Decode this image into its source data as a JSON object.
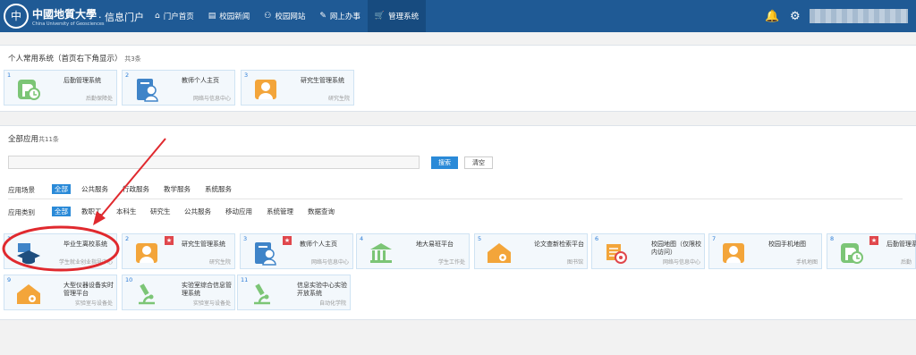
{
  "header": {
    "logo_mark": "中",
    "logo_text": "中國地質大學",
    "logo_sub": "China University of Geosciences",
    "portal_title": "· 信息门户",
    "nav": [
      {
        "label": "门户首页",
        "icon": "⌂"
      },
      {
        "label": "校园新闻",
        "icon": "▤"
      },
      {
        "label": "校园网站",
        "icon": "⚇"
      },
      {
        "label": "网上办事",
        "icon": "✎"
      },
      {
        "label": "管理系统",
        "icon": "🛒"
      }
    ],
    "bell_icon": "🔔",
    "gear_icon": "⚙"
  },
  "common": {
    "title": "个人常用系统（首页右下角显示）",
    "count": "共3条",
    "cards": [
      {
        "num": "1",
        "name": "后勤管理系统",
        "dept": "后勤保障处",
        "icon": "logistics-icon"
      },
      {
        "num": "2",
        "name": "教师个人主页",
        "dept": "网络与信息中心",
        "icon": "teacher-icon"
      },
      {
        "num": "3",
        "name": "研究生管理系统",
        "dept": "研究生院",
        "icon": "graduate-icon"
      }
    ]
  },
  "all": {
    "title": "全部应用",
    "count": "共11条",
    "search_placeholder": "",
    "search_label": "搜索",
    "clear_label": "清空",
    "scene_label": "应用场景",
    "scene_options": [
      "全部",
      "公共服务",
      "行政服务",
      "教学服务",
      "系统服务"
    ],
    "type_label": "应用类别",
    "type_options": [
      "全部",
      "教职工",
      "本科生",
      "研究生",
      "公共服务",
      "移动应用",
      "系统管理",
      "数据查询"
    ],
    "cards": [
      {
        "num": "1",
        "name": "毕业生离校系统",
        "dept": "学生就业创业指导中心",
        "icon": "graduation-icon",
        "star": false
      },
      {
        "num": "2",
        "name": "研究生管理系统",
        "dept": "研究生院",
        "icon": "graduate-icon",
        "star": true
      },
      {
        "num": "3",
        "name": "教师个人主页",
        "dept": "网络与信息中心",
        "icon": "teacher-icon",
        "star": true
      },
      {
        "num": "4",
        "name": "地大易班平台",
        "dept": "学生工作处",
        "icon": "library-icon",
        "star": false
      },
      {
        "num": "5",
        "name": "论文查新检索平台",
        "dept": "图书馆",
        "icon": "house-gear-icon",
        "star": false
      },
      {
        "num": "6",
        "name": "校园地图（仅限校内访问）",
        "dept": "网络与信息中心",
        "icon": "map-gear-icon",
        "star": false
      },
      {
        "num": "7",
        "name": "校园手机地图",
        "dept": "手机地图",
        "icon": "person-icon",
        "star": false
      },
      {
        "num": "8",
        "name": "后勤管理系统",
        "dept": "后勤",
        "icon": "logistics-icon",
        "star": true
      },
      {
        "num": "9",
        "name": "大型仪器设备实时管理平台",
        "dept": "实验室与设备处",
        "icon": "house-gear-icon",
        "star": false
      },
      {
        "num": "10",
        "name": "实验室综合信息管理系统",
        "dept": "实验室与设备处",
        "icon": "microscope-icon",
        "star": false
      },
      {
        "num": "11",
        "name": "信息实验中心实验开放系统",
        "dept": "自动化学院",
        "icon": "microscope-icon",
        "star": false
      }
    ]
  },
  "colors": {
    "header": "#1f5a95",
    "accent": "#2a8ad8",
    "annotation": "#e0292e"
  }
}
